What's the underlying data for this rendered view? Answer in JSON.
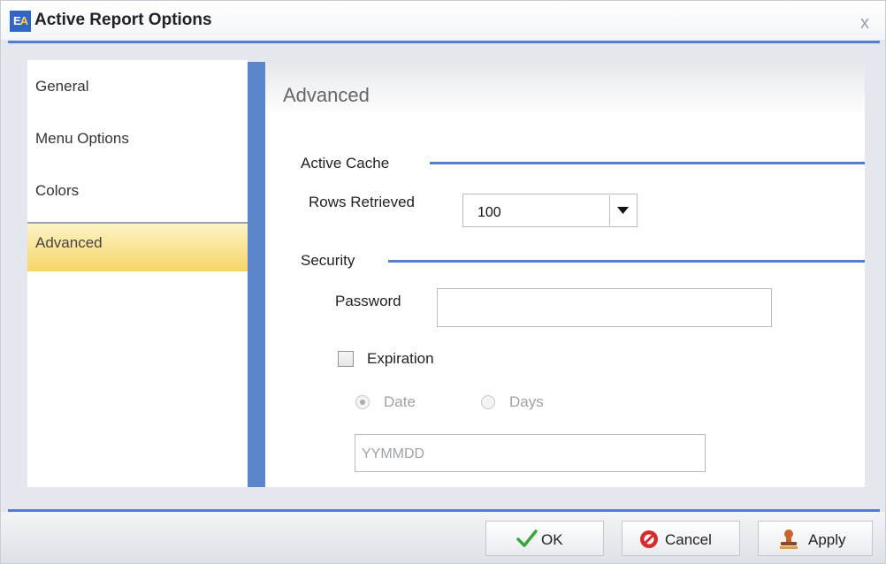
{
  "window": {
    "title": "Active Report Options",
    "app_icon": "ea-logo-icon",
    "close_glyph": "x"
  },
  "nav": {
    "items": [
      {
        "label": "General"
      },
      {
        "label": "Menu Options"
      },
      {
        "label": "Colors"
      },
      {
        "label": "Advanced",
        "active": true
      }
    ]
  },
  "panel": {
    "title": "Advanced",
    "active_cache": {
      "heading": "Active Cache",
      "rows_retrieved_label": "Rows Retrieved",
      "rows_retrieved_value": "100"
    },
    "security": {
      "heading": "Security",
      "password_label": "Password",
      "password_value": "",
      "expiration_label": "Expiration",
      "expiration_checked": false,
      "date_label": "Date",
      "days_label": "Days",
      "date_selected": true,
      "date_placeholder": "YYMMDD"
    }
  },
  "footer": {
    "ok_label": "OK",
    "cancel_label": "Cancel",
    "apply_label": "Apply"
  },
  "colors": {
    "accent_blue": "#4f7fce",
    "active_tab": "#f6d665"
  }
}
